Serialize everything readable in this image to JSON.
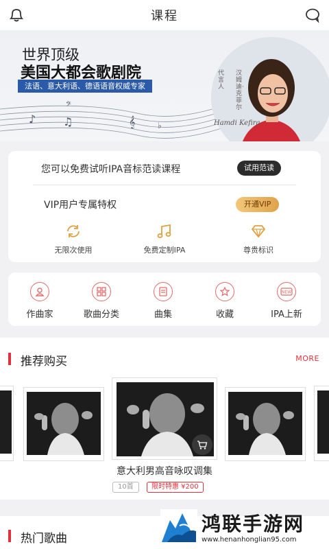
{
  "header": {
    "title": "课程",
    "left_icon": "bell-icon",
    "right_icon": "chat-bubble-icon"
  },
  "banner": {
    "line1": "世界顶级",
    "line2": "美国大都会歌剧院",
    "strip": "法语、意大利语、德语语音权威专家",
    "signature": "Hamdi Kefira",
    "vertical_left": "代言人",
    "vertical_right": "汉姆迪·克菲尔"
  },
  "trial": {
    "text": "您可以免费试听IPA音标范读课程",
    "button": "试用范读"
  },
  "vip": {
    "text": "VIP用户专属特权",
    "button": "开通VIP",
    "perks": [
      {
        "icon": "refresh-icon",
        "label": "无限次使用"
      },
      {
        "icon": "music-note-icon",
        "label": "免费定制IPA"
      },
      {
        "icon": "diamond-icon",
        "label": "尊贵标识"
      }
    ]
  },
  "categories": [
    {
      "icon": "composer-icon",
      "label": "作曲家"
    },
    {
      "icon": "grid-icon",
      "label": "歌曲分类"
    },
    {
      "icon": "album-icon",
      "label": "曲集"
    },
    {
      "icon": "star-icon",
      "label": "收藏"
    },
    {
      "icon": "new-badge-icon",
      "label": "IPA上新"
    }
  ],
  "recommend": {
    "title": "推荐购买",
    "more": "MORE",
    "album_title": "意大利男高音咏叹调集",
    "count": "10首",
    "price_tag": "限时特惠 ¥200"
  },
  "hot": {
    "title": "热门歌曲"
  },
  "watermark": {
    "name": "鸿联手游网",
    "url": "www.henanhonglian95.com"
  },
  "colors": {
    "accent": "#e0323c",
    "banner_strip": "#2a5aa8",
    "vip_gold": "#e8b060"
  }
}
